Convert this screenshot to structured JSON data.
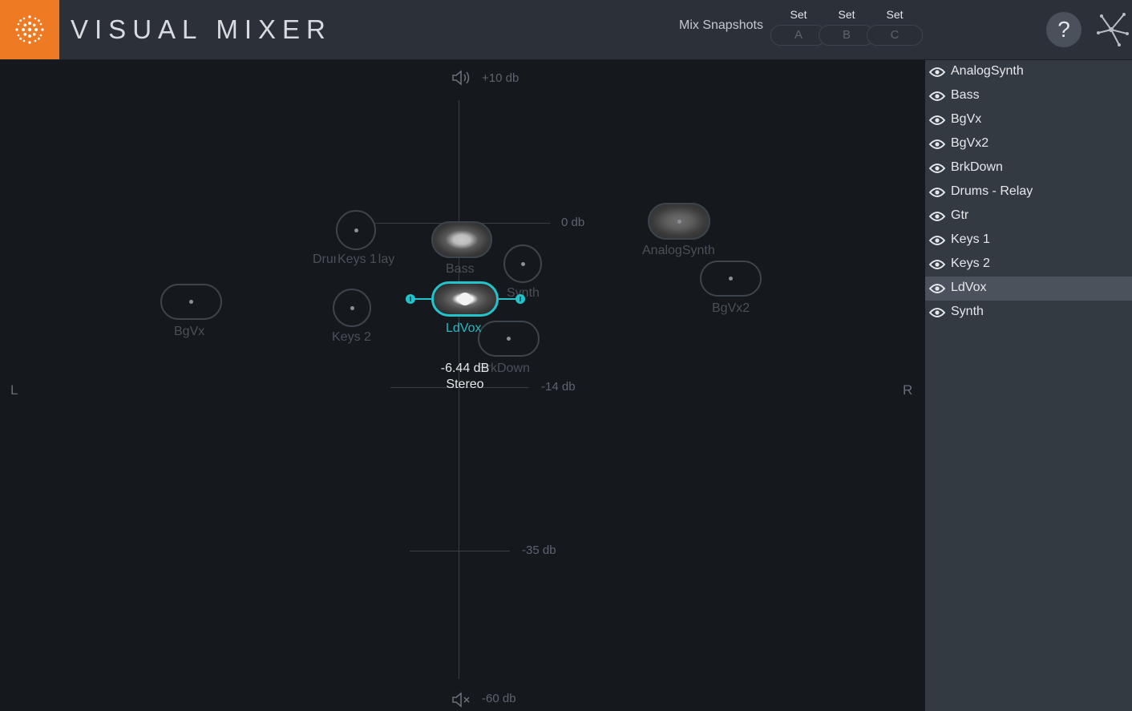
{
  "header": {
    "title": "VISUAL MIXER",
    "snapshots_label": "Mix Snapshots",
    "snapshots": [
      {
        "set_label": "Set",
        "slot": "A"
      },
      {
        "set_label": "Set",
        "slot": "B"
      },
      {
        "set_label": "Set",
        "slot": "C"
      }
    ],
    "help_label": "?",
    "accent_color": "#ee7a24"
  },
  "stage": {
    "db_labels": {
      "top": "+10 db",
      "zero": "0 db",
      "mid": "-14 db",
      "low": "-35 db",
      "bottom": "-60 db"
    },
    "left_label": "L",
    "right_label": "R",
    "tracks": {
      "drums": "Drums - Relay",
      "keys1": "Keys 1",
      "bass": "Bass",
      "synth": "Synth",
      "analogsynth": "AnalogSynth",
      "bgvx": "BgVx",
      "keys2": "Keys 2",
      "ldvox": "LdVox",
      "brkdown": "BrkDown",
      "bgvx2": "BgVx2"
    },
    "selected": {
      "name": "LdVox",
      "gain": "-6.44 dB",
      "mode": "Stereo",
      "accent_color": "#22c3ca"
    }
  },
  "sidebar": {
    "items": [
      {
        "label": "AnalogSynth",
        "icon": "eye-icon"
      },
      {
        "label": "Bass",
        "icon": "eye-icon"
      },
      {
        "label": "BgVx",
        "icon": "eye-icon"
      },
      {
        "label": "BgVx2",
        "icon": "eye-icon"
      },
      {
        "label": "BrkDown",
        "icon": "eye-icon"
      },
      {
        "label": "Drums - Relay",
        "icon": "eye-icon"
      },
      {
        "label": "Gtr",
        "icon": "eye-icon"
      },
      {
        "label": "Keys 1",
        "icon": "eye-icon"
      },
      {
        "label": "Keys 2",
        "icon": "eye-icon"
      },
      {
        "label": "LdVox",
        "icon": "eye-icon",
        "selected": true
      },
      {
        "label": "Synth",
        "icon": "eye-icon"
      }
    ]
  }
}
